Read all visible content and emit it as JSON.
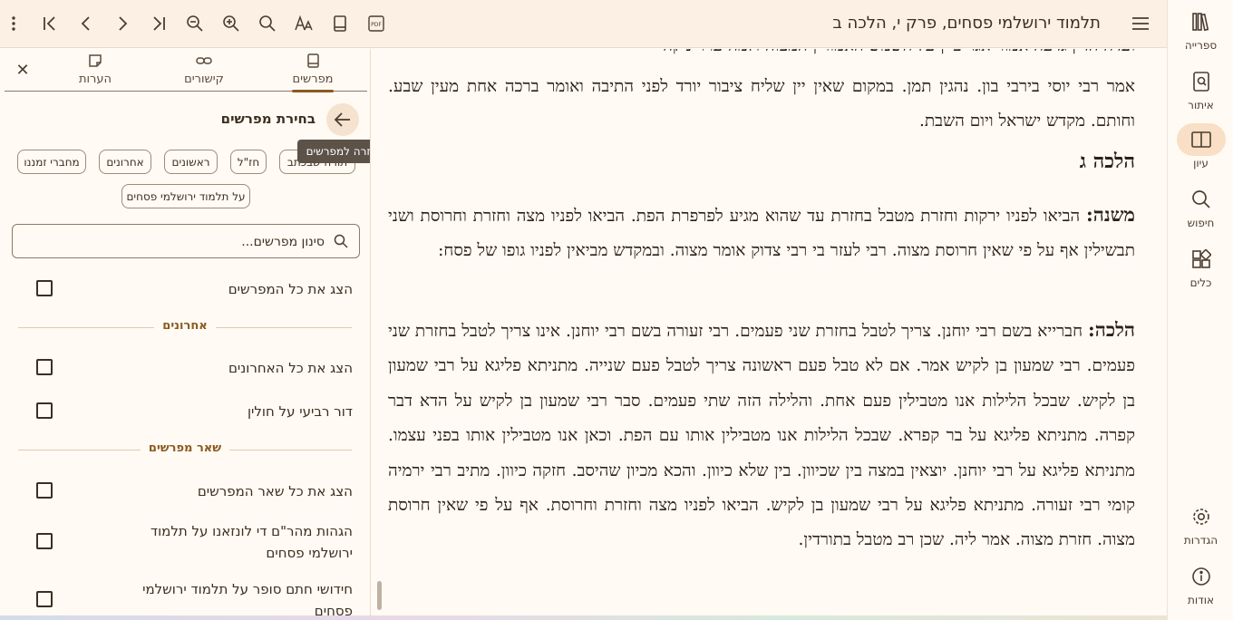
{
  "toolbar": {
    "title": "תלמוד ירושלמי פסחים, פרק י, הלכה ב",
    "icons": [
      "more-vertical-icon",
      "first-page-icon",
      "previous-icon",
      "next-icon",
      "last-page-icon",
      "zoom-out-icon",
      "zoom-in-icon",
      "search-icon",
      "font-size-icon",
      "book-icon",
      "pdf-icon",
      "menu-icon"
    ]
  },
  "rail": {
    "items": [
      {
        "label": "ספרייה",
        "icon": "library-icon"
      },
      {
        "label": "איתור",
        "icon": "locate-icon"
      },
      {
        "label": "עיון",
        "icon": "open-book-icon",
        "active": true
      },
      {
        "label": "חיפוש",
        "icon": "search-icon"
      },
      {
        "label": "כלים",
        "icon": "tools-icon"
      },
      {
        "label": "הגדרות",
        "icon": "settings-icon"
      },
      {
        "label": "אודות",
        "icon": "info-icon"
      }
    ]
  },
  "panel": {
    "tabs": [
      {
        "label": "מפרשים",
        "icon": "book-icon",
        "active": true
      },
      {
        "label": "קישורים",
        "icon": "link-icon"
      },
      {
        "label": "הערות",
        "icon": "note-icon"
      }
    ],
    "selection_title": "בחירת מפרשים",
    "back_tooltip": "חזרה למפרשים",
    "chips": [
      "תורה שבכתב",
      "חז\"ל",
      "ראשונים",
      "אחרונים",
      "מחברי זמננו",
      "על תלמוד ירושלמי פסחים"
    ],
    "filter_placeholder": "סינון מפרשים...",
    "show_all": "הצג את כל המפרשים",
    "sections": [
      {
        "title": "אחרונים",
        "items": [
          "הצג את כל האחרונים",
          "דור רביעי על חולין"
        ]
      },
      {
        "title": "שאר מפרשים",
        "items": [
          "הצג את כל שאר המפרשים",
          "הגהות מהר\"ם די לונזאנו על תלמוד ירושלמי פסחים",
          "חידושי חתם סופר על תלמוד ירושלמי פסחים"
        ]
      }
    ]
  },
  "content": {
    "top_partial": "ועדה הדין גדעה אמור אגר ביין על השמש האמורין המצוה ולמה ערר ניקה",
    "para1": "אמר רבי יוסי בירבי בון. נהגין תמן. במקום שאין יין שליח ציבור יורד לפני התיבה ואומר ברכה אחת מעין שבע. וחותם. מקדש ישראל ויום השבת.",
    "heading": "הלכה ג",
    "mishna_label": "משנה:",
    "mishna": "הביאו לפניו ירקות וחזרת מטבל בחזרת עד שהוא מגיע לפרפרת הפת. הביאו לפניו מצה וחזרת וחרוסת ושני תבשילין אף על פי שאין חרוסת מצוה. רבי לעזר בי רבי צדוק אומר מצוה. ובמקדש מביאין לפניו גופו של פסח:",
    "halacha_label": "הלכה:",
    "halacha": "חברייא בשם רבי יוחנן. צריך לטבל בחזרת שני פעמים. רבי זעורה בשם רבי יוחנן. אינו צריך לטבל בחזרת שני פעמים. רבי שמעון בן לקיש אמר. אם לא טבל פעם ראשונה צריך לטבל פעם שנייה. מתניתא פליגא על רבי שמעון בן לקיש. שבכל הלילות אנו מטבילין פעם אחת. והלילה הזה שתי פעמים. סבר רבי שמעון בן לקיש על הדא דבר קפרה. מתניתא פליגא על בר קפרא. שבכל הלילות אנו מטבילין אותו עם הפת. וכאן אנו מטבילין אותו בפני עצמו. מתניתא פליגא על רבי יוחנן. יוצאין במצה בין שכיוון. בין שלא כיוון. והכא מכיון שהיסב. חזקה כיוון. מתיב רבי ירמיה קומי רבי זעורה. מתניתא פליגא על רבי שמעון בן לקיש. הביאו לפניו מצה וחזרת וחרוסת. אף על פי שאין חרוסת מצוה. חזרת מצוה. אמר ליה. שכן רב מטבל בתורדין."
  }
}
